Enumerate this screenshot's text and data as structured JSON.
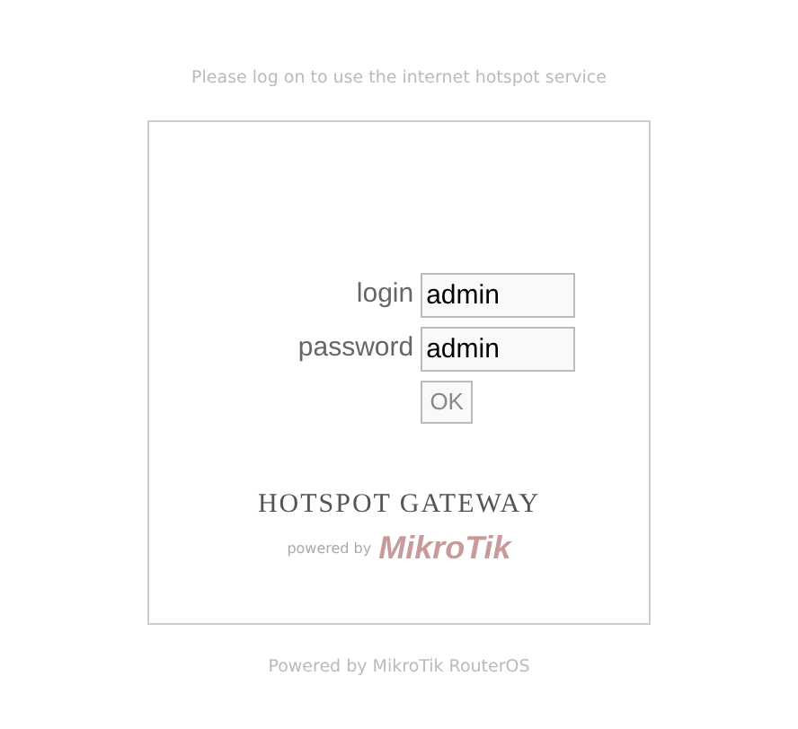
{
  "header": "Please log on to use the internet hotspot service",
  "form": {
    "fields": [
      {
        "label": "login",
        "value": "admin",
        "kind": "text"
      },
      {
        "label": "password",
        "value": "admin",
        "kind": "text"
      }
    ],
    "button": "OK"
  },
  "brand": {
    "title": "HOTSPOT GATEWAY",
    "powered": "powered by",
    "logo": "MikroTik"
  },
  "footer": "Powered by MikroTik RouterOS"
}
